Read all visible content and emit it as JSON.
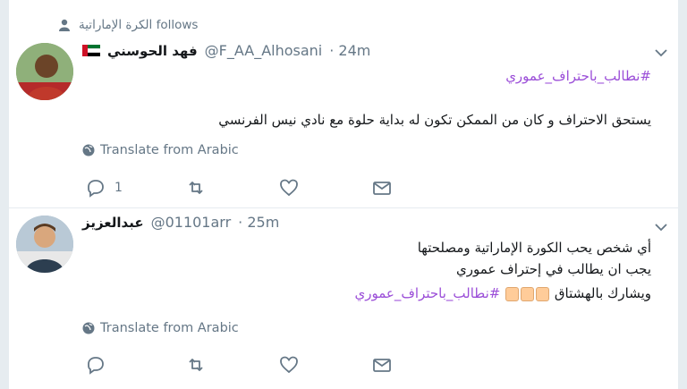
{
  "context": {
    "account": "الكرة الإماراتية",
    "follows_text": "follows"
  },
  "tweets": [
    {
      "name": "فهد الحوسني",
      "handle": "@F_AA_Alhosani",
      "time": "· 24m",
      "hashtag": "#نطالب_باحتراف_عموري",
      "text": "يستحق الاحتراف و كان من الممكن تكون له بداية حلوة مع نادي نيس الفرنسي",
      "translate": "Translate from Arabic",
      "reply_count": "1"
    },
    {
      "name": "عبدالعزيز",
      "handle": "@01101arr",
      "time": "· 25m",
      "line1": "أي شخص يحب الكورة الإماراتية ومصلحتها",
      "line2": "يجب ان يطالب في إحتراف عموري",
      "line3_text": "ويشارك بالهشتاق",
      "hashtag": "#نطالب_باحتراف_عموري",
      "translate": "Translate from Arabic"
    }
  ],
  "colors": {
    "link": "#9b4ed8",
    "muted": "#657786",
    "text": "#14171a"
  },
  "icons": [
    "person-icon",
    "uae-flag-icon",
    "chevron-down-icon",
    "globe-icon",
    "reply-icon",
    "retweet-icon",
    "like-icon",
    "message-icon",
    "thumbs-up-emoji"
  ]
}
